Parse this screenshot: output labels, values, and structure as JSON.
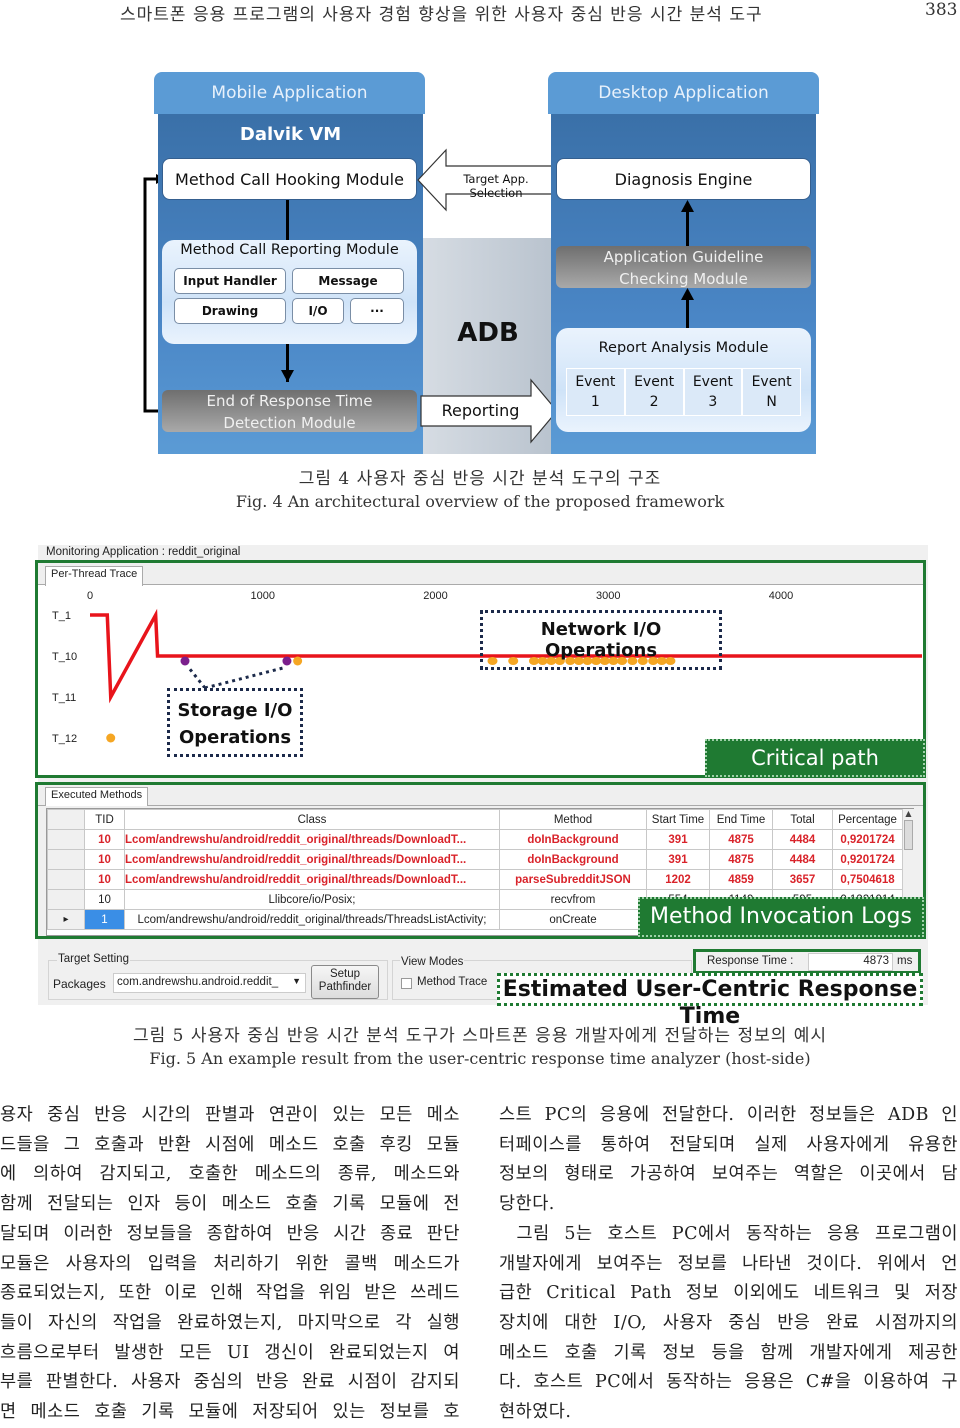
{
  "header": {
    "running_title": "스마트폰 응용 프로그램의 사용자 경험 향상을 위한 사용자 중심 반응 시간 분석 도구",
    "page_number": "383"
  },
  "figure4": {
    "mobile": {
      "title": "Mobile Application",
      "vm": "Dalvik VM",
      "hooking": "Method Call Hooking Module",
      "reporting_module": {
        "title": "Method Call Reporting Module",
        "items": [
          "Input Handler",
          "Message",
          "Drawing",
          "I/O",
          "···"
        ]
      },
      "end_detection": [
        "End of Response Time",
        "Detection Module"
      ]
    },
    "adb": {
      "label": "ADB",
      "reporting_arrow": "Reporting",
      "selection_arrow": "Target App. Selection"
    },
    "desktop": {
      "title": "Desktop Application",
      "diagnosis": "Diagnosis Engine",
      "guideline": [
        "Application Guideline",
        "Checking Module"
      ],
      "report_analysis": {
        "title": "Report Analysis Module",
        "events": [
          {
            "line1": "Event",
            "line2": "1"
          },
          {
            "line1": "Event",
            "line2": "2"
          },
          {
            "line1": "Event",
            "line2": "3"
          },
          {
            "line1": "Event",
            "line2": "N"
          }
        ]
      }
    },
    "caption_ko": "그림 4 사용자 중심 반응 시간 분석 도구의 구조",
    "caption_en": "Fig. 4 An architectural overview of the proposed framework"
  },
  "figure5": {
    "monitoring_label": "Monitoring Application :  reddit_original",
    "trace_tab": "Per-Thread Trace",
    "chart_data": {
      "type": "line",
      "title": "Per-Thread Trace",
      "x_ticks": [
        "0",
        "1000",
        "2000",
        "3000",
        "4000"
      ],
      "xlim": [
        0,
        4800
      ],
      "threads": [
        "T_1",
        "T_10",
        "T_11",
        "T_12"
      ],
      "critical_path": [
        {
          "x": 0,
          "thread": "T_1"
        },
        {
          "x": 100,
          "thread": "T_1"
        },
        {
          "x": 120,
          "thread": "T_11"
        },
        {
          "x": 380,
          "thread": "T_1"
        },
        {
          "x": 391,
          "thread": "T_10"
        },
        {
          "x": 4875,
          "thread": "T_10"
        }
      ],
      "storage_io_points": [
        {
          "x": 550,
          "thread": "T_10",
          "color": "#7b1f8c"
        },
        {
          "x": 1140,
          "thread": "T_10",
          "color": "#7b1f8c"
        },
        {
          "x": 1202,
          "thread": "T_10",
          "color": "#f5a623"
        }
      ],
      "other_points": [
        {
          "x": 120,
          "thread": "T_12",
          "color": "#f5a623"
        }
      ],
      "network_io_points_x": [
        2330,
        2450,
        2570,
        2620,
        2670,
        2720,
        2780,
        2830,
        2880,
        2930,
        2980,
        3030,
        3080,
        3140,
        3200,
        3260,
        3310,
        3360
      ],
      "annotations": [
        "Storage I/O Operations",
        "Network I/O Operations",
        "Critical path"
      ]
    },
    "methods_tab": "Executed Methods",
    "table": {
      "columns": [
        "TID",
        "Class",
        "Method",
        "Start Time",
        "End Time",
        "Total",
        "Percentage"
      ],
      "rows": [
        {
          "tid": "10",
          "class": "Lcom/andrewshu/android/reddit_original/threads/DownloadT...",
          "method": "doInBackground",
          "start": "391",
          "end": "4875",
          "total": "4484",
          "pct": "0,9201724",
          "highlight": true
        },
        {
          "tid": "10",
          "class": "Lcom/andrewshu/android/reddit_original/threads/DownloadT...",
          "method": "doInBackground",
          "start": "391",
          "end": "4875",
          "total": "4484",
          "pct": "0,9201724",
          "highlight": true
        },
        {
          "tid": "10",
          "class": "Lcom/andrewshu/android/reddit_original/threads/DownloadT...",
          "method": "parseSubredditJSON",
          "start": "1202",
          "end": "4859",
          "total": "3657",
          "pct": "0,7504618",
          "highlight": true
        },
        {
          "tid": "10",
          "class": "Llibcore/io/Posix;",
          "method": "recvfrom",
          "start": "554",
          "end": "1149",
          "total": "595",
          "pct": "0,1221014",
          "highlight": false
        },
        {
          "tid": "1",
          "class": "Lcom/andrewshu/android/reddit_original/threads/ThreadsListActivity;",
          "method": "onCreate",
          "start": "",
          "end": "",
          "total": "",
          "pct": "",
          "highlight": false,
          "selected": true
        }
      ]
    },
    "method_logs_label": "Method Invocation Logs",
    "target_setting": {
      "group": "Target Setting",
      "packages_label": "Packages",
      "packages_value": "com.andrewshu.android.reddit_",
      "setup_button": [
        "Setup",
        "Pathfinder"
      ]
    },
    "view_modes": {
      "group": "View Modes",
      "method_trace": "Method Trace",
      "method_trace_checked": false
    },
    "response_time": {
      "label": "Response Time :",
      "value": "4873",
      "unit": "ms"
    },
    "response_label": "Estimated User-Centric Response Time",
    "caption_ko": "그림 5 사용자 중심 반응 시간 분석 도구가 스마트폰 응용 개발자에게 전달하는 정보의 예시",
    "caption_en": "Fig. 5 An example result from the user-centric response time analyzer (host-side)"
  },
  "body": {
    "left_column": [
      "용자 중심 반응 시간의 판별과 연관이 있는 모든 메소",
      "드들을 그 호출과 반환 시점에 메소드 호출 후킹 모듈",
      "에 의하여 감지되고, 호출한 메소드의 종류, 메소드와",
      "함께 전달되는 인자 등이 메소드 호출 기록 모듈에 전",
      "달되며 이러한 정보들을 종합하여 반응 시간 종료 판단",
      "모듈은 사용자의 입력을 처리하기 위한 콜백 메소드가",
      "종료되었는지, 또한 이로 인해 작업을 위임 받은 쓰레드",
      "들이 자신의 작업을 완료하였는지, 마지막으로 각 실행",
      "흐름으로부터 발생한 모든 UI 갱신이 완료되었는지 여",
      "부를 판별한다. 사용자 중심의 반응 완료 시점이 감지되",
      "면 메소드 호출 기록 모듈에 저장되어 있는 정보를 호"
    ],
    "right_column": [
      "스트 PC의 응용에 전달한다. 이러한 정보들은 ADB 인",
      "터페이스를 통하여 전달되며 실제 사용자에게 유용한",
      "정보의 형태로 가공하여 보여주는 역할은 이곳에서 담",
      "당한다.",
      "  그림 5는 호스트 PC에서 동작하는 응용 프로그램이",
      "개발자에게 보여주는 정보를 나타낸 것이다. 위에서 언",
      "급한 Critical Path 정보 이외에도 네트워크 및 저장",
      "장치에 대한 I/O, 사용자 중심 반응 완료 시점까지의",
      "메소드 호출 기록 정보 등을 함께 개발자에게 제공한",
      "다. 호스트 PC에서 동작하는 응용은 C#을 이용하여 구",
      "현하였다."
    ]
  }
}
